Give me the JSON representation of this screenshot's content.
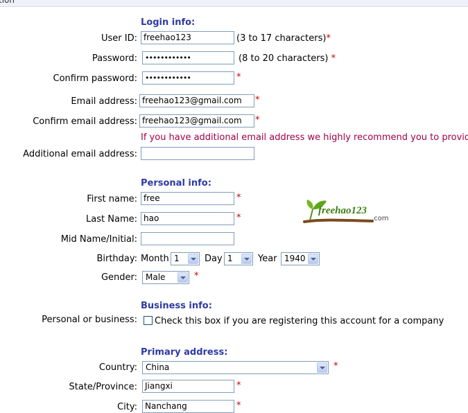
{
  "header": {
    "partial_title": "tion"
  },
  "login": {
    "heading": "Login info:",
    "user_id": {
      "label": "User ID:",
      "value": "freehao123",
      "hint": "(3 to 17 characters)",
      "req": "*"
    },
    "password": {
      "label": "Password:",
      "value": "••••••••••••",
      "hint": "(8 to 20 characters)",
      "req": "*"
    },
    "confirm_password": {
      "label": "Confirm password:",
      "value": "••••••••••••",
      "req": "*"
    },
    "email": {
      "label": "Email address:",
      "value": "freehao123@gmail.com",
      "req": "*"
    },
    "confirm_email": {
      "label": "Confirm email address:",
      "value": "freehao123@gmail.com",
      "req": "*"
    },
    "notice": "If you have additional email address we highly recommend you to provide i",
    "additional_email": {
      "label": "Additional email address:",
      "value": ""
    }
  },
  "personal": {
    "heading": "Personal info:",
    "first_name": {
      "label": "First name:",
      "value": "free",
      "req": "*"
    },
    "last_name": {
      "label": "Last Name:",
      "value": "hao",
      "req": "*"
    },
    "mid_name": {
      "label": "Mid Name/Initial:",
      "value": ""
    },
    "birthday": {
      "label": "Birthday:",
      "month_label": "Month",
      "month": "1",
      "day_label": "Day",
      "day": "1",
      "year_label": "Year",
      "year": "1940"
    },
    "gender": {
      "label": "Gender:",
      "value": "Male",
      "req": "*"
    }
  },
  "logo": {
    "text": "freehao123",
    "suffix": ".com"
  },
  "business": {
    "heading": "Business info:",
    "label": "Personal or business:",
    "checkbox_text": "Check this box if you are registering this account for a company",
    "checked": false
  },
  "address": {
    "heading": "Primary address:",
    "country": {
      "label": "Country:",
      "value": "China",
      "req": "*"
    },
    "state": {
      "label": "State/Province:",
      "value": "Jiangxi",
      "req": "*"
    },
    "city": {
      "label": "City:",
      "value": "Nanchang",
      "req": "*"
    }
  },
  "colors": {
    "section_heading": "#2e3aa5",
    "required": "#cc0000",
    "notice": "#a0004a",
    "field_border": "#7f9db9"
  }
}
